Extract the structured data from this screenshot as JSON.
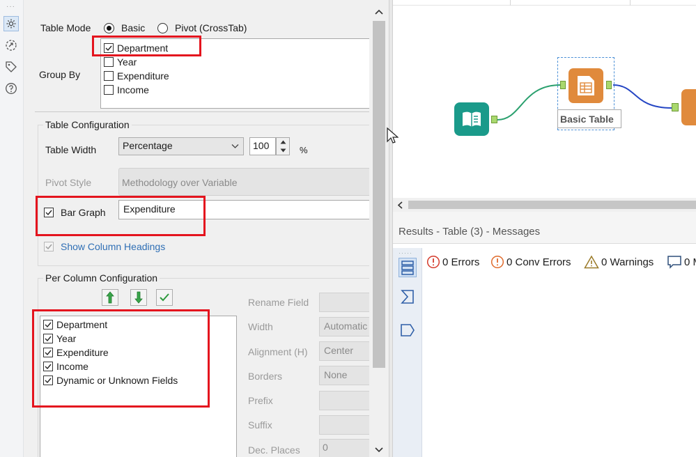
{
  "table_mode": {
    "label": "Table Mode",
    "basic": "Basic",
    "pivot": "Pivot (CrossTab)"
  },
  "group_by": {
    "label": "Group By",
    "items": [
      "Department",
      "Year",
      "Expenditure",
      "Income"
    ],
    "checked": [
      true,
      false,
      false,
      false
    ]
  },
  "table_config": {
    "title": "Table Configuration",
    "width_label": "Table Width",
    "width_mode": "Percentage",
    "width_value": "100",
    "width_unit": "%",
    "pivot_style_label": "Pivot Style",
    "pivot_style_value": "Methodology over Variable",
    "bar_graph_label": "Bar Graph",
    "bar_graph_field": "Expenditure",
    "show_headings_label": "Show Column Headings"
  },
  "per_column": {
    "title": "Per Column Configuration",
    "fields": [
      "Department",
      "Year",
      "Expenditure",
      "Income",
      "Dynamic or Unknown Fields"
    ],
    "props": {
      "rename": "Rename Field",
      "width": "Width",
      "width_value": "Automatic",
      "alignment": "Alignment (H)",
      "alignment_value": "Center",
      "borders": "Borders",
      "borders_value": "None",
      "prefix": "Prefix",
      "suffix": "Suffix",
      "dec_places": "Dec. Places",
      "dec_places_value": "0"
    }
  },
  "canvas": {
    "tool_label": "Basic Table"
  },
  "results": {
    "header": "Results - Table (3) - Messages",
    "errors": "0 Errors",
    "conv_errors": "0 Conv Errors",
    "warnings": "0 Warnings",
    "messages": "0 M"
  },
  "colors": {
    "highlight": "#e4141e",
    "input_tool": "#1a9a8a",
    "table_tool": "#e08a3c"
  }
}
